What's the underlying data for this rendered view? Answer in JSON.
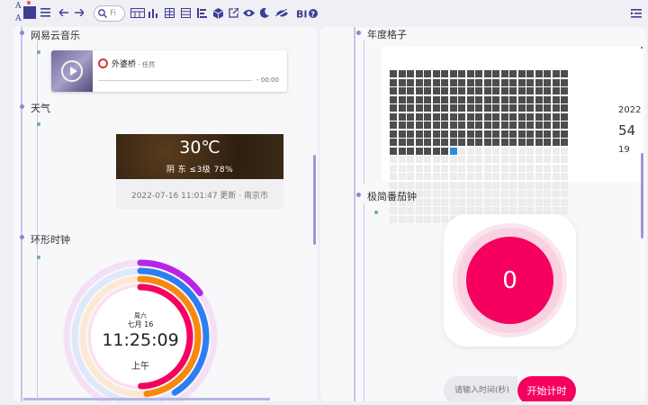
{
  "toolbar": {
    "font_label": "A",
    "search_placeholder": "Fi",
    "items": [
      "table-calendar-icon",
      "bar-chart-icon",
      "grid-icon",
      "list-icon",
      "align-icon",
      "cube-icon",
      "external-link-icon",
      "eye-icon",
      "moon-icon",
      "eye-slash-icon",
      "bold-italic-help-icon"
    ]
  },
  "left": {
    "music": {
      "heading": "网易云音乐",
      "song": "外婆桥",
      "artist": " - 任然",
      "time": "- 00:00"
    },
    "weather": {
      "heading": "天气",
      "temp": "30℃",
      "condition": "阴 东 ≤3级 78%",
      "updated": "2022-07-16 11:01:47 更新 · 南京市"
    },
    "clock": {
      "heading": "环形时钟",
      "weekday": "周六",
      "date": "七月 16",
      "time": "11:25:09",
      "period": "上午"
    }
  },
  "right": {
    "year": {
      "heading": "年度格子",
      "year": "2022",
      "percent": "54",
      "remaining": "19",
      "filled_days": 196,
      "today_index": 196,
      "total_days": 365
    },
    "pomodoro": {
      "heading": "极简番茄钟",
      "count": "0",
      "placeholder": "请输入时间(秒)",
      "start_label": "开始计时"
    }
  },
  "colors": {
    "accent": "#3d3f93",
    "pink": "#f5005e",
    "grid_filled": "#4d4d4d",
    "grid_today": "#2b8be0",
    "grid_empty": "#ececec"
  }
}
